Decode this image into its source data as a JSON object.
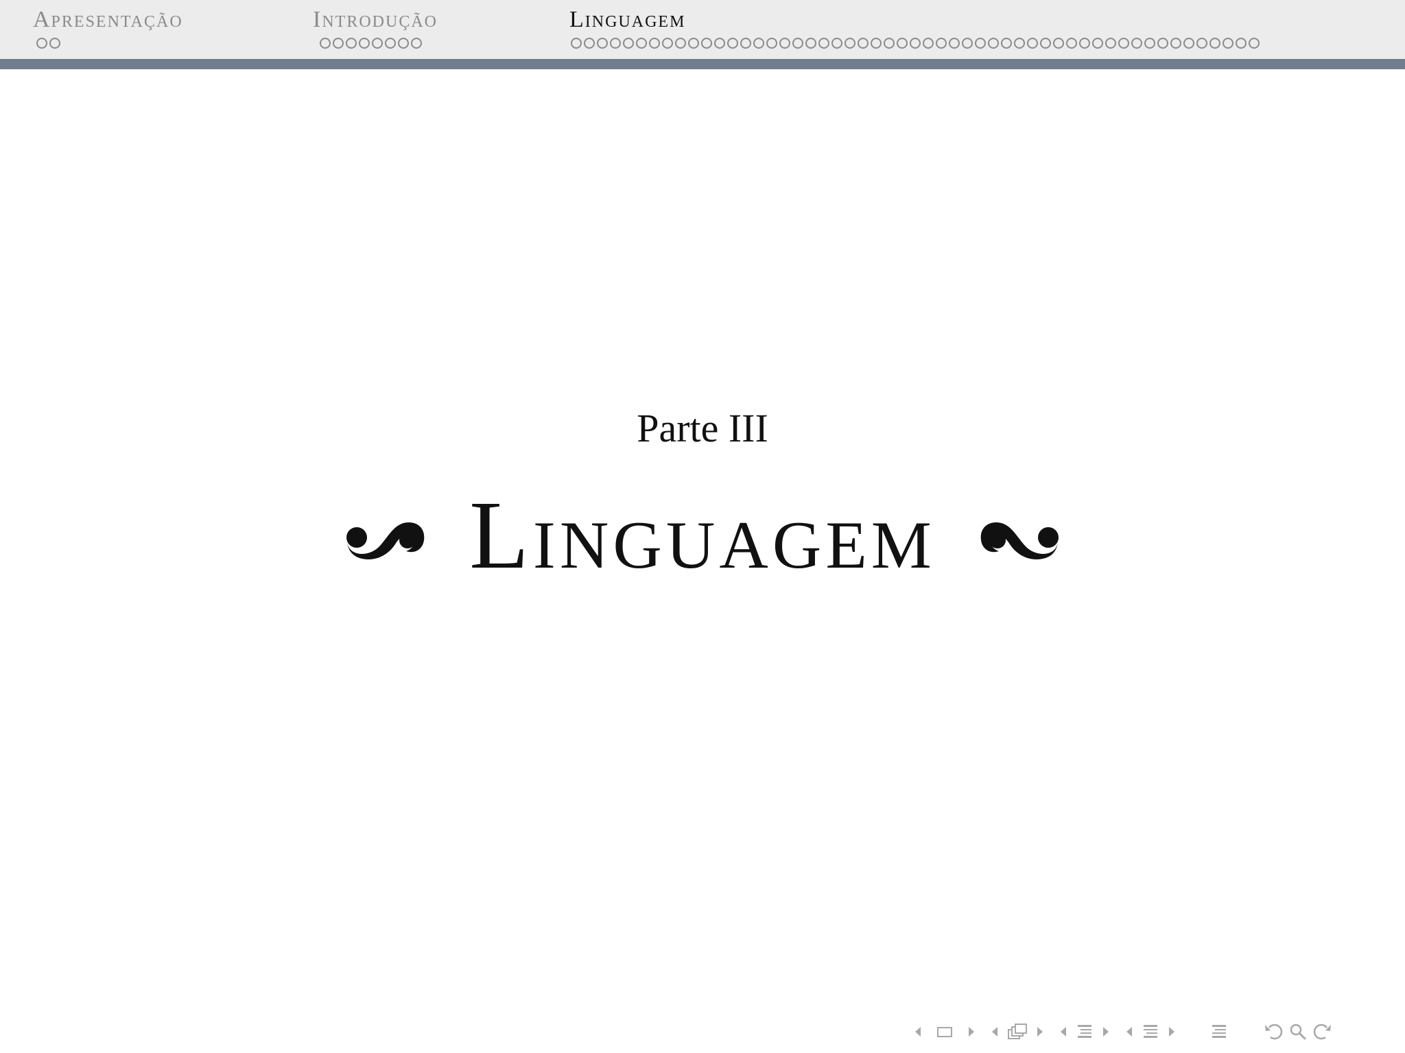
{
  "header": {
    "sections": [
      {
        "title": "Apresentação",
        "active": false,
        "frames": 2
      },
      {
        "title": "Introdução",
        "active": false,
        "frames": 8
      },
      {
        "title": "Linguagem",
        "active": true,
        "frames": 53
      }
    ]
  },
  "main": {
    "part_label": "Parte III",
    "part_title": "Linguagem"
  },
  "navigation": {
    "icons": [
      "arrow-left-icon",
      "frame-icon",
      "arrow-right-icon",
      "arrow-left-icon",
      "subsection-icon",
      "arrow-right-icon",
      "arrow-left-icon",
      "section-icon",
      "arrow-right-icon",
      "arrow-left-icon",
      "part-icon",
      "arrow-right-icon",
      "document-icon",
      "back-icon",
      "search-icon",
      "forward-icon"
    ]
  },
  "colors": {
    "headline_background": "#ececec",
    "headline_bar": "#6f7d8f",
    "inactive_text": "#8a8a8a",
    "active_text": "#111111",
    "nav_icons": "#a8a8a8"
  }
}
